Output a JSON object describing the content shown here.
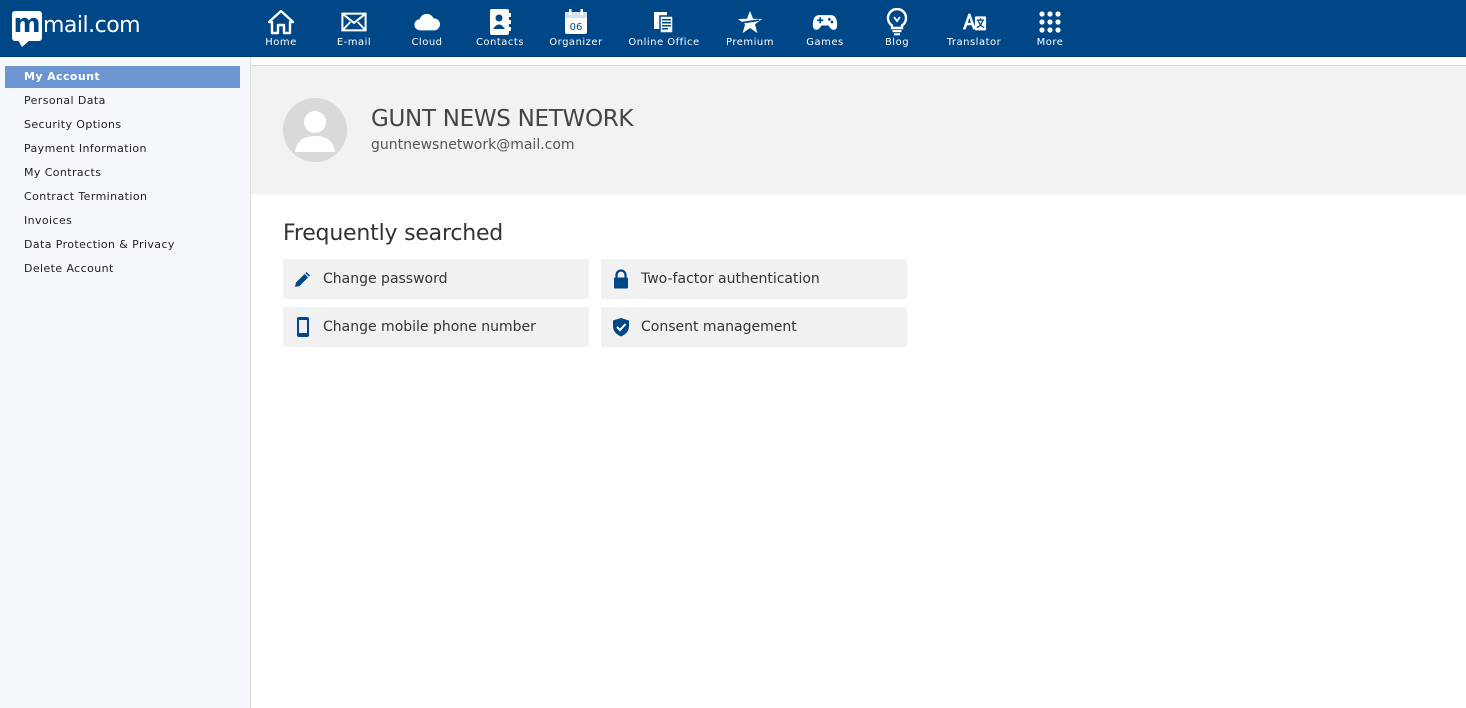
{
  "brand": {
    "logo_text": "mail.com",
    "primary_color": "#004788",
    "active_color": "#6c95d1"
  },
  "nav": {
    "items": [
      {
        "label": "Home",
        "icon": "home-icon"
      },
      {
        "label": "E-mail",
        "icon": "envelope-icon"
      },
      {
        "label": "Cloud",
        "icon": "cloud-icon"
      },
      {
        "label": "Contacts",
        "icon": "contacts-icon"
      },
      {
        "label": "Organizer",
        "icon": "calendar-icon",
        "calendar_day": "06"
      },
      {
        "label": "Online Office",
        "icon": "office-documents-icon"
      },
      {
        "label": "Premium",
        "icon": "star-icon"
      },
      {
        "label": "Games",
        "icon": "gamepad-icon"
      },
      {
        "label": "Blog",
        "icon": "lightbulb-icon"
      },
      {
        "label": "Translator",
        "icon": "translator-icon"
      },
      {
        "label": "More",
        "icon": "grid-dots-icon"
      }
    ]
  },
  "sidebar": {
    "items": [
      {
        "label": "My Account",
        "active": true
      },
      {
        "label": "Personal Data"
      },
      {
        "label": "Security Options"
      },
      {
        "label": "Payment Information"
      },
      {
        "label": "My Contracts"
      },
      {
        "label": "Contract Termination"
      },
      {
        "label": "Invoices"
      },
      {
        "label": "Data Protection & Privacy"
      },
      {
        "label": "Delete Account"
      }
    ]
  },
  "profile": {
    "name": "GUNT NEWS NETWORK",
    "email": "guntnewsnetwork@mail.com"
  },
  "frequently_searched": {
    "title": "Frequently searched",
    "items": [
      {
        "label": "Change password",
        "icon": "pencil-icon"
      },
      {
        "label": "Two-factor authentication",
        "icon": "lock-icon"
      },
      {
        "label": "Change mobile phone number",
        "icon": "mobile-phone-icon"
      },
      {
        "label": "Consent management",
        "icon": "shield-check-icon"
      }
    ]
  }
}
